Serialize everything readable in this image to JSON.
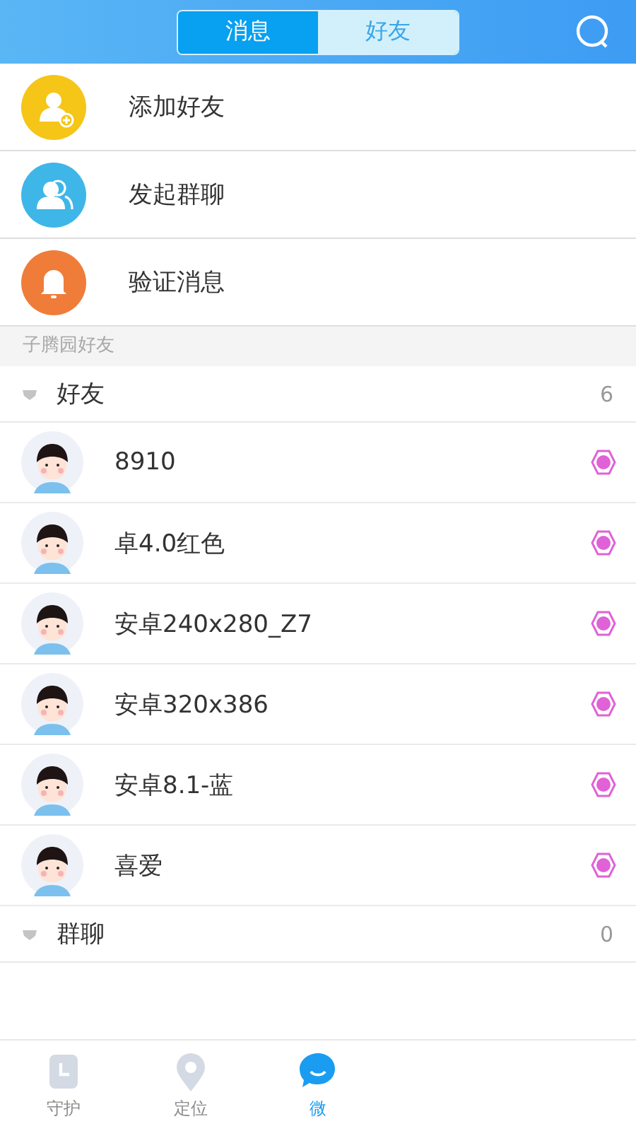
{
  "header": {
    "tabs": [
      {
        "label": "消息",
        "selected": true
      },
      {
        "label": "好友",
        "selected": false
      }
    ]
  },
  "actions": [
    {
      "label": "添加好友",
      "kind": "add",
      "color": "#f5c518"
    },
    {
      "label": "发起群聊",
      "kind": "group",
      "color": "#3fb6e8"
    },
    {
      "label": "验证消息",
      "kind": "bell",
      "color": "#f07c3a"
    }
  ],
  "section_title": "子腾园好友",
  "groups": [
    {
      "name": "好友",
      "count": "6",
      "members": [
        {
          "name": "8910"
        },
        {
          "name": "卓4.0红色"
        },
        {
          "name": "安卓240x280_Z7"
        },
        {
          "name": "安卓320x386"
        },
        {
          "name": "安卓8.1-蓝"
        },
        {
          "name": "喜爱"
        }
      ]
    },
    {
      "name": "群聊",
      "count": "0"
    }
  ],
  "nav": [
    {
      "label": "守护",
      "kind": "watch",
      "selected": false
    },
    {
      "label": "定位",
      "kind": "pin",
      "selected": false
    },
    {
      "label": "微",
      "kind": "chat",
      "selected": true
    }
  ]
}
